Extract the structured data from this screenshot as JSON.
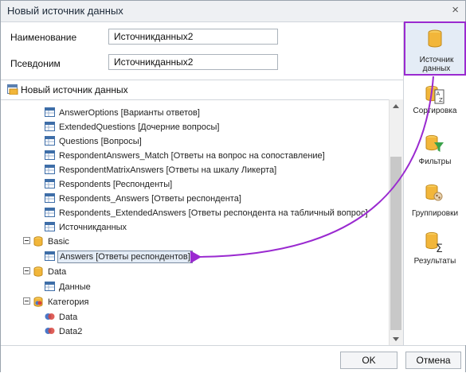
{
  "title": "Новый источник данных",
  "close_glyph": "×",
  "form": {
    "name_label": "Наименование",
    "name_value": "Источникданных2",
    "alias_label": "Псевдоним",
    "alias_value": "Источникданных2"
  },
  "tree_header": "Новый источник данных",
  "tree": {
    "tables_top": [
      "AnswerOptions [Варианты ответов]",
      "ExtendedQuestions [Дочерние вопросы]",
      "Questions [Вопросы]",
      "RespondentAnswers_Match [Ответы на вопрос на сопоставление]",
      "RespondentMatrixAnswers [Ответы на шкалу Ликерта]",
      "Respondents [Респонденты]",
      "Respondents_Answers [Ответы респондента]",
      "Respondents_ExtendedAnswers [Ответы респондента на табличный вопрос]",
      "Источникданных"
    ],
    "basic": "Basic",
    "basic_child": "Answers [Ответы респондентов]",
    "data": "Data",
    "data_child": "Данные",
    "category": "Категория",
    "category_children": [
      "Data",
      "Data2"
    ]
  },
  "side_buttons": {
    "source": [
      "Источник",
      "данных"
    ],
    "sort": "Сортировка",
    "filters": "Фильтры",
    "group": "Группировки",
    "results": "Результаты"
  },
  "buttons": {
    "ok": "OK",
    "cancel": "Отмена"
  },
  "colors": {
    "annotation": "#9a2ad0",
    "db_icon": "#f2b63a"
  }
}
